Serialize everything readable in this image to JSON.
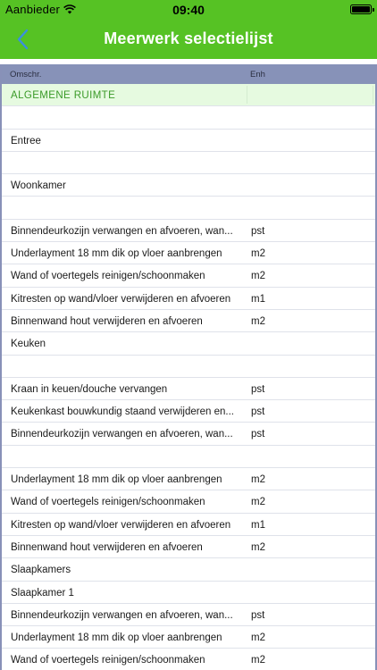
{
  "status_bar": {
    "carrier": "Aanbieder",
    "time": "09:40"
  },
  "nav": {
    "title": "Meerwerk selectielijst",
    "back_icon": "chevron-left-icon"
  },
  "colors": {
    "accent": "#56c224",
    "table_header": "#8792b8",
    "group_row_bg": "#e6fae0",
    "group_row_text": "#3a9a28"
  },
  "table": {
    "columns": {
      "description": "Omschr.",
      "unit": "Enh"
    },
    "rows": [
      {
        "desc": "ALGEMENE RUIMTE",
        "unit": "",
        "type": "group"
      },
      {
        "desc": "",
        "unit": "",
        "type": "item"
      },
      {
        "desc": "Entree",
        "unit": "",
        "type": "item"
      },
      {
        "desc": "",
        "unit": "",
        "type": "item"
      },
      {
        "desc": "Woonkamer",
        "unit": "",
        "type": "item"
      },
      {
        "desc": "",
        "unit": "",
        "type": "item"
      },
      {
        "desc": "Binnendeurkozijn verwangen en afvoeren, wan...",
        "unit": "pst",
        "type": "item"
      },
      {
        "desc": "Underlayment 18 mm dik op vloer aanbrengen",
        "unit": "m2",
        "type": "item"
      },
      {
        "desc": "Wand of voertegels reinigen/schoonmaken",
        "unit": "m2",
        "type": "item"
      },
      {
        "desc": "Kitresten op wand/vloer verwijderen en afvoeren",
        "unit": "m1",
        "type": "item"
      },
      {
        "desc": "Binnenwand hout verwijderen en afvoeren",
        "unit": "m2",
        "type": "item"
      },
      {
        "desc": "Keuken",
        "unit": "",
        "type": "item"
      },
      {
        "desc": "",
        "unit": "",
        "type": "item"
      },
      {
        "desc": "Kraan in keuen/douche vervangen",
        "unit": "pst",
        "type": "item"
      },
      {
        "desc": "Keukenkast bouwkundig staand verwijderen en...",
        "unit": "pst",
        "type": "item"
      },
      {
        "desc": "Binnendeurkozijn verwangen en afvoeren, wan...",
        "unit": "pst",
        "type": "item"
      },
      {
        "desc": "",
        "unit": "",
        "type": "item"
      },
      {
        "desc": "Underlayment 18 mm dik op vloer aanbrengen",
        "unit": "m2",
        "type": "item"
      },
      {
        "desc": "Wand of voertegels reinigen/schoonmaken",
        "unit": "m2",
        "type": "item"
      },
      {
        "desc": "Kitresten op wand/vloer verwijderen en afvoeren",
        "unit": "m1",
        "type": "item"
      },
      {
        "desc": "Binnenwand hout verwijderen en afvoeren",
        "unit": "m2",
        "type": "item"
      },
      {
        "desc": "Slaapkamers",
        "unit": "",
        "type": "item"
      },
      {
        "desc": "Slaapkamer 1",
        "unit": "",
        "type": "item"
      },
      {
        "desc": "Binnendeurkozijn verwangen en afvoeren, wan...",
        "unit": "pst",
        "type": "item"
      },
      {
        "desc": "Underlayment 18 mm dik op vloer aanbrengen",
        "unit": "m2",
        "type": "item"
      },
      {
        "desc": "Wand of voertegels reinigen/schoonmaken",
        "unit": "m2",
        "type": "item"
      }
    ]
  }
}
